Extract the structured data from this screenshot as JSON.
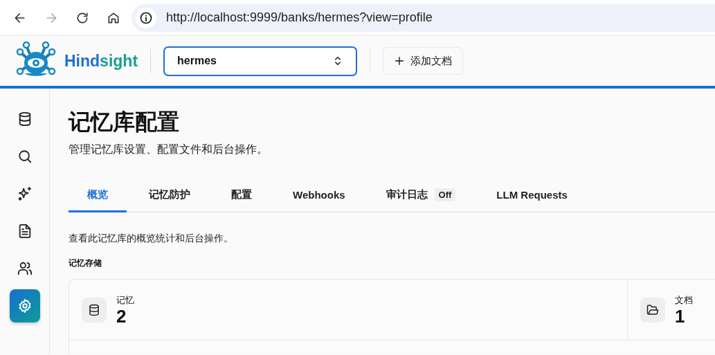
{
  "browser": {
    "nav": [
      {
        "kind": "back",
        "disabled": false
      },
      {
        "kind": "forward",
        "disabled": true
      },
      {
        "kind": "reload",
        "disabled": false
      },
      {
        "kind": "home",
        "disabled": false
      }
    ],
    "url": "http://localhost:9999/banks/hermes?view=profile"
  },
  "header": {
    "logo": [
      {
        "text": "Hind",
        "color": "#1f6fd6"
      },
      {
        "text": "sight",
        "color": "#16a092"
      }
    ],
    "bank_select": {
      "value": "hermes"
    },
    "add_button": {
      "label": "添加文档"
    }
  },
  "sidebar": {
    "items": [
      {
        "kind": "database",
        "selected": false
      },
      {
        "kind": "search",
        "selected": false
      },
      {
        "kind": "sparkles",
        "selected": false
      },
      {
        "kind": "document",
        "selected": false
      },
      {
        "kind": "users",
        "selected": false
      },
      {
        "kind": "settings",
        "selected": true
      }
    ]
  },
  "page": {
    "title": "记忆库配置",
    "subtitle": "管理记忆库设置、配置文件和后台操作。",
    "tabs": [
      {
        "label": "概览",
        "selected": true
      },
      {
        "label": "记忆防护",
        "selected": false
      },
      {
        "label": "配置",
        "selected": false
      },
      {
        "label": "Webhooks",
        "selected": false
      },
      {
        "label": "审计日志",
        "selected": false,
        "badge": "Off"
      },
      {
        "label": "LLM Requests",
        "selected": false
      }
    ],
    "description": "查看此记忆库的概览统计和后台操作。",
    "section_label": "记忆存储",
    "stats": [
      {
        "kind": "database",
        "label": "记忆",
        "value": "2"
      },
      {
        "kind": "folder",
        "label": "文档",
        "value": "1"
      }
    ]
  }
}
